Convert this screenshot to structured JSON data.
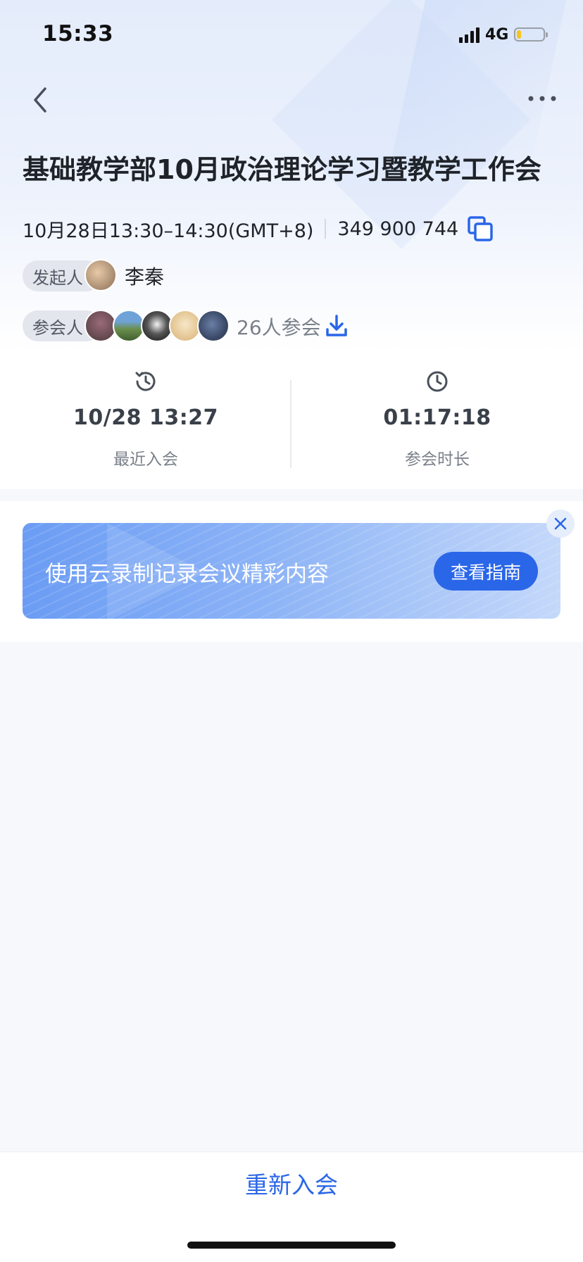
{
  "status_bar": {
    "time": "15:33",
    "network": "4G",
    "battery_level": 0.18
  },
  "meeting": {
    "title": "基础教学部10月政治理论学习暨教学工作会",
    "time_range": "10月28日13:30–14:30(GMT+8)",
    "meeting_id": "349 900 744",
    "host_label": "发起人",
    "host_name": "李秦",
    "attendee_label": "参会人",
    "attendee_count": "26人参会"
  },
  "stats": {
    "last_join": {
      "value": "10/28 13:27",
      "label": "最近入会"
    },
    "duration": {
      "value": "01:17:18",
      "label": "参会时长"
    }
  },
  "banner": {
    "text": "使用云录制记录会议精彩内容",
    "button_label": "查看指南"
  },
  "footer": {
    "rejoin_label": "重新入会"
  },
  "colors": {
    "accent": "#2a66e8",
    "title": "#1f2329",
    "muted": "#7a808a"
  },
  "icons": [
    "back-icon",
    "more-icon",
    "copy-icon",
    "download-icon",
    "history-icon",
    "clock-icon",
    "close-icon"
  ]
}
